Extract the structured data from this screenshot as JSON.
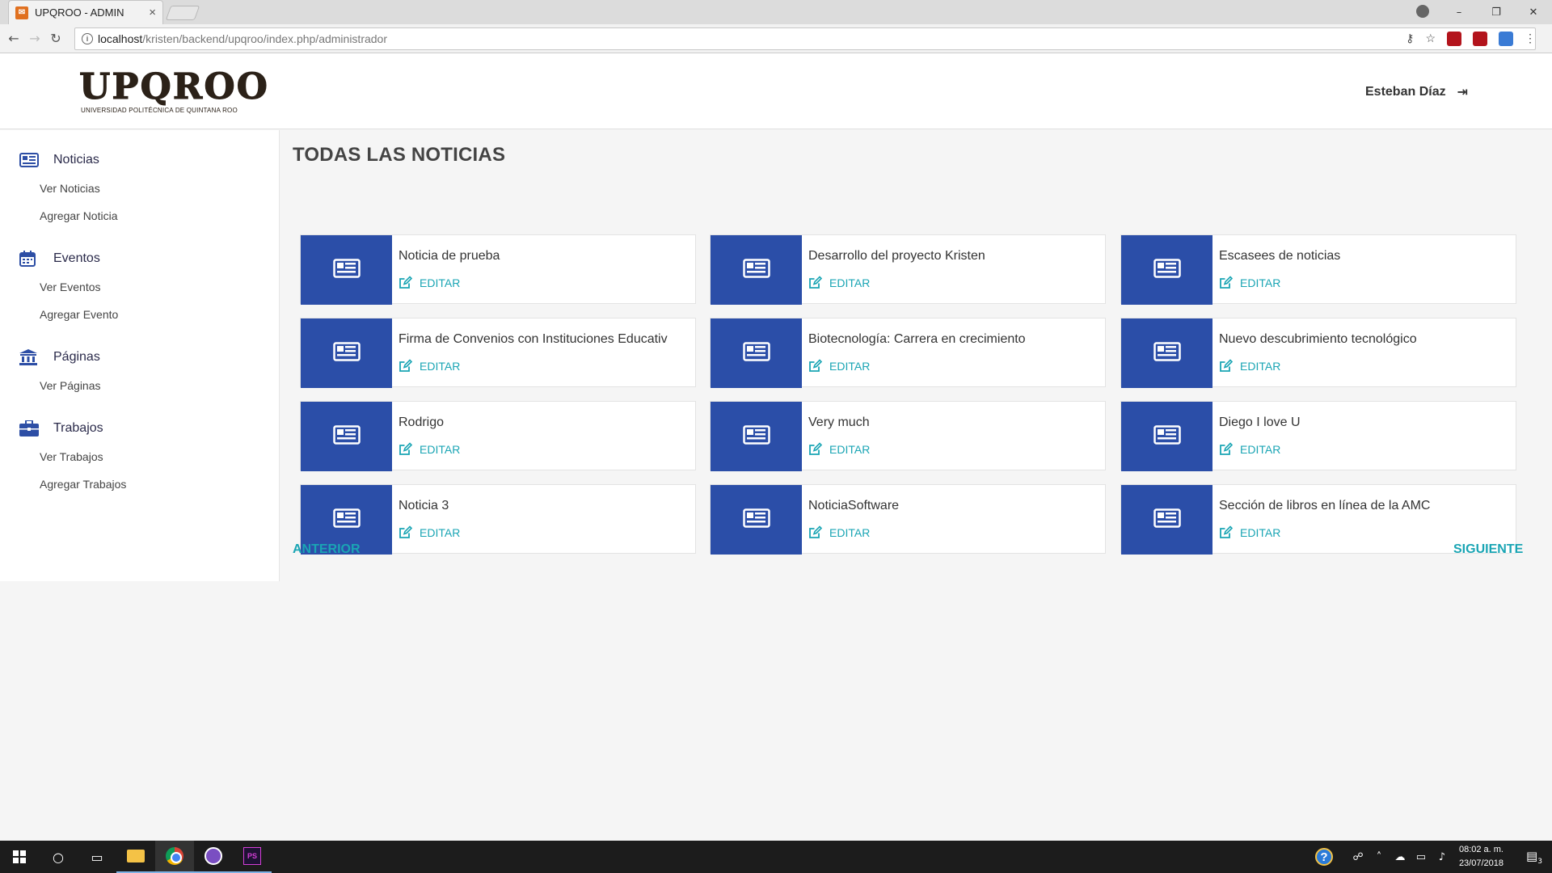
{
  "browser": {
    "tab_title": "UPQROO - ADMIN",
    "url_host": "localhost",
    "url_path": "/kristen/backend/upqroo/index.php/administrador"
  },
  "header": {
    "logo_text": "UPQROO",
    "logo_subtitle": "UNIVERSIDAD POLITÉCNICA DE QUINTANA ROO",
    "user_name": "Esteban Díaz"
  },
  "sidebar": {
    "groups": [
      {
        "label": "Noticias",
        "icon": "newspaper-icon",
        "links": [
          "Ver Noticias",
          "Agregar Noticia"
        ]
      },
      {
        "label": "Eventos",
        "icon": "calendar-icon",
        "links": [
          "Ver Eventos",
          "Agregar Evento"
        ]
      },
      {
        "label": "Páginas",
        "icon": "institution-icon",
        "links": [
          "Ver Páginas"
        ]
      },
      {
        "label": "Trabajos",
        "icon": "briefcase-icon",
        "links": [
          "Ver Trabajos",
          "Agregar Trabajos"
        ]
      }
    ]
  },
  "main": {
    "title": "TODAS LAS NOTICIAS",
    "edit_label": "EDITAR",
    "news": [
      "Noticia de prueba",
      "Desarrollo del proyecto Kristen",
      "Escasees de noticias",
      "Firma de Convenios con Instituciones Educativ",
      "Biotecnología: Carrera en crecimiento",
      "Nuevo descubrimiento tecnológico",
      "Rodrigo",
      "Very much",
      "Diego I love U",
      "Noticia 3",
      "NoticiaSoftware",
      "Sección de libros en línea de la AMC"
    ],
    "prev_label": "ANTERIOR",
    "next_label": "SIGUIENTE"
  },
  "taskbar": {
    "time": "08:02 a. m.",
    "date": "23/07/2018",
    "notifications": "3"
  },
  "colors": {
    "accent_blue": "#2b4ea8",
    "link_teal": "#1aa5b4"
  }
}
